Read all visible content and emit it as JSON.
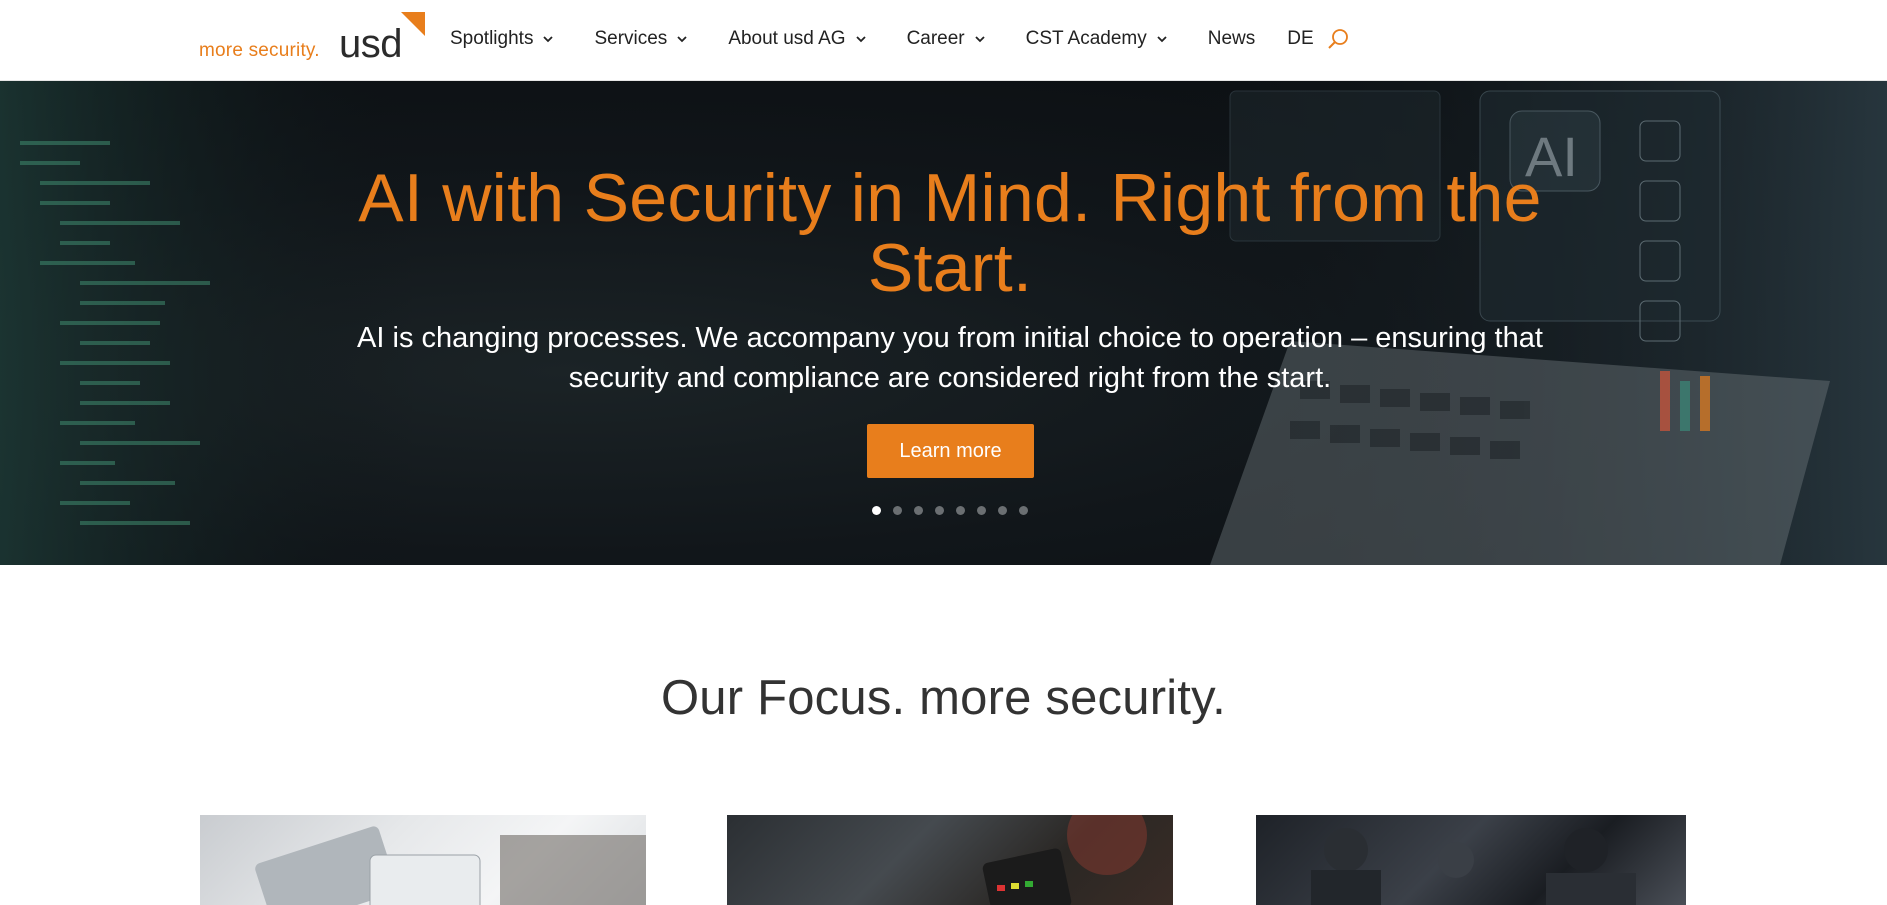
{
  "header": {
    "logo_tagline": "more security.",
    "logo_wordmark": "usd",
    "nav": [
      {
        "label": "Spotlights",
        "has_dropdown": true
      },
      {
        "label": "Services",
        "has_dropdown": true
      },
      {
        "label": "About usd AG",
        "has_dropdown": true
      },
      {
        "label": "Career",
        "has_dropdown": true
      },
      {
        "label": "CST Academy",
        "has_dropdown": true
      },
      {
        "label": "News",
        "has_dropdown": false
      }
    ],
    "language": "DE",
    "search_icon": "search-icon"
  },
  "hero": {
    "title": "AI with Security in Mind. Right from the Start.",
    "subtitle": "AI is changing processes. We accompany you from initial choice to operation – ensuring that security and compliance are considered right from the start.",
    "button_label": "Learn more",
    "slides_total": 8,
    "active_slide": 1
  },
  "focus": {
    "title": "Our Focus. more security."
  },
  "colors": {
    "accent": "#e87e1c",
    "text": "#222222",
    "hero_bg": "#0f1418"
  }
}
